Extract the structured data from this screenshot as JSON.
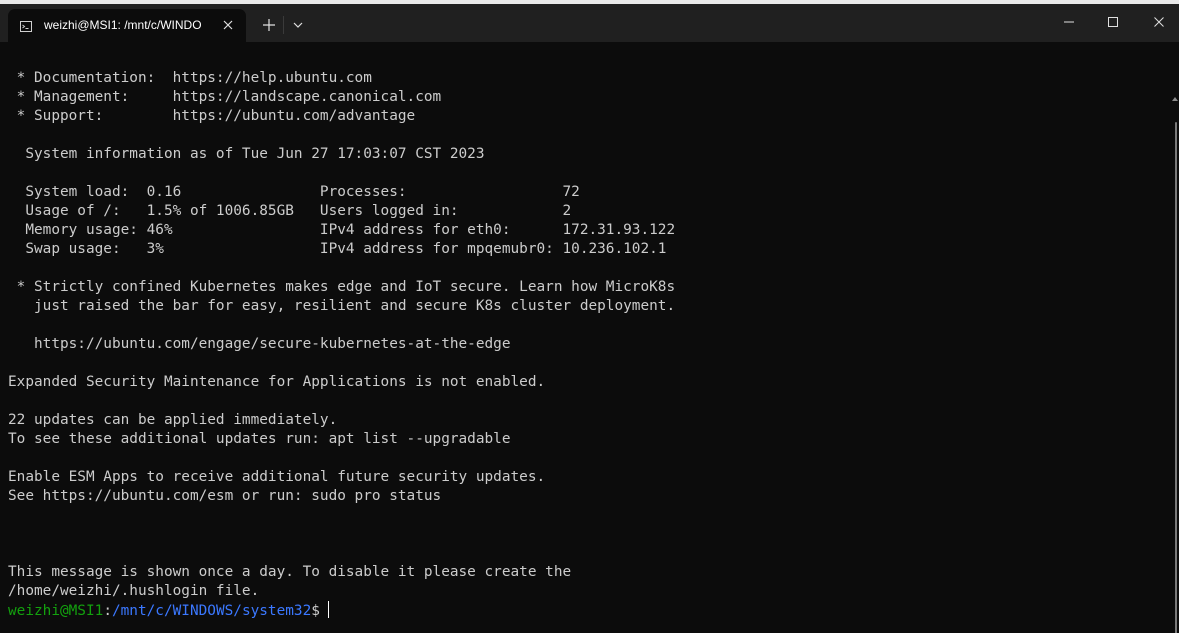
{
  "window": {
    "tab_title": "weizhi@MSI1: /mnt/c/WINDO",
    "icons": [
      "terminal-icon",
      "close-icon",
      "plus-icon",
      "chevron-down-icon",
      "minimize-icon",
      "maximize-icon",
      "close-icon"
    ]
  },
  "terminal": {
    "lines": [
      " * Documentation:  https://help.ubuntu.com",
      " * Management:     https://landscape.canonical.com",
      " * Support:        https://ubuntu.com/advantage",
      "",
      "  System information as of Tue Jun 27 17:03:07 CST 2023",
      "",
      "  System load:  0.16                Processes:                  72",
      "  Usage of /:   1.5% of 1006.85GB   Users logged in:            2",
      "  Memory usage: 46%                 IPv4 address for eth0:      172.31.93.122",
      "  Swap usage:   3%                  IPv4 address for mpqemubr0: 10.236.102.1",
      "",
      " * Strictly confined Kubernetes makes edge and IoT secure. Learn how MicroK8s",
      "   just raised the bar for easy, resilient and secure K8s cluster deployment.",
      "",
      "   https://ubuntu.com/engage/secure-kubernetes-at-the-edge",
      "",
      "Expanded Security Maintenance for Applications is not enabled.",
      "",
      "22 updates can be applied immediately.",
      "To see these additional updates run: apt list --upgradable",
      "",
      "Enable ESM Apps to receive additional future security updates.",
      "See https://ubuntu.com/esm or run: sudo pro status",
      "",
      "",
      "",
      "This message is shown once a day. To disable it please create the",
      "/home/weizhi/.hushlogin file."
    ],
    "prompt": {
      "user_host": "weizhi@MSI1",
      "separator": ":",
      "path": "/mnt/c/WINDOWS/system32",
      "symbol": "$"
    }
  },
  "colors": {
    "background": "#0c0c0c",
    "titlebar": "#202020",
    "text": "#cccccc",
    "prompt_user": "#13a10e",
    "prompt_path": "#3b78ff"
  }
}
